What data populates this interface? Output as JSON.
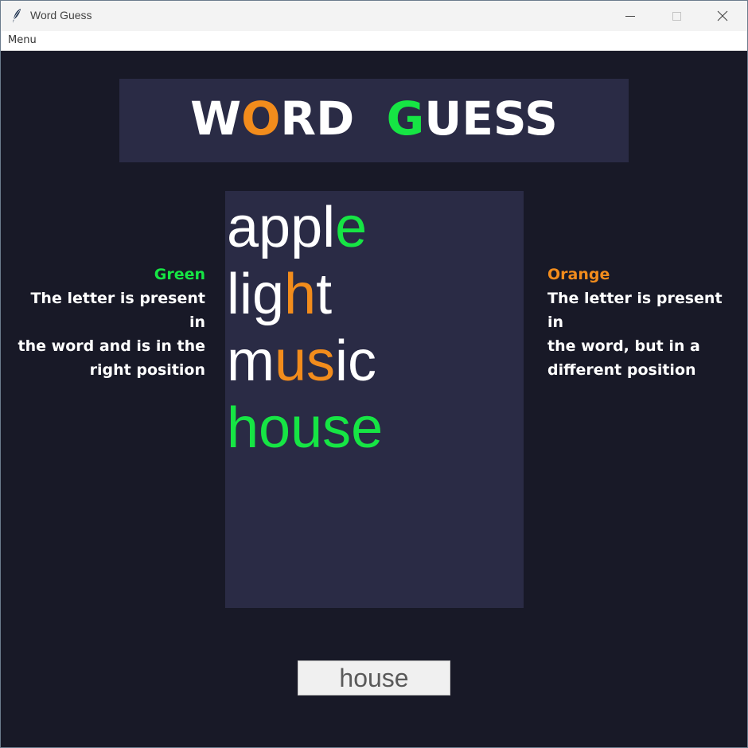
{
  "window": {
    "title": "Word Guess",
    "app_icon": "feather-icon",
    "controls": {
      "minimize": "minimize-icon",
      "maximize": "maximize-icon",
      "close": "close-icon"
    }
  },
  "menubar": {
    "items": [
      "Menu"
    ]
  },
  "header": {
    "segments": [
      {
        "text": "W",
        "color": "#ffffff"
      },
      {
        "text": "O",
        "color": "#f28c1c"
      },
      {
        "text": "RD  ",
        "color": "#ffffff"
      },
      {
        "text": "G",
        "color": "#16e544"
      },
      {
        "text": "UESS",
        "color": "#ffffff"
      }
    ]
  },
  "colors": {
    "green": "#16e544",
    "orange": "#f28c1c",
    "white": "#ffffff",
    "panel": "#2a2b45",
    "background": "#181927"
  },
  "guesses": [
    {
      "word": "apple",
      "letters": [
        {
          "ch": "a",
          "color": "#ffffff"
        },
        {
          "ch": "p",
          "color": "#ffffff"
        },
        {
          "ch": "p",
          "color": "#ffffff"
        },
        {
          "ch": "l",
          "color": "#ffffff"
        },
        {
          "ch": "e",
          "color": "#16e544"
        }
      ]
    },
    {
      "word": "light",
      "letters": [
        {
          "ch": "l",
          "color": "#ffffff"
        },
        {
          "ch": "i",
          "color": "#ffffff"
        },
        {
          "ch": "g",
          "color": "#ffffff"
        },
        {
          "ch": "h",
          "color": "#f28c1c"
        },
        {
          "ch": "t",
          "color": "#ffffff"
        }
      ]
    },
    {
      "word": "music",
      "letters": [
        {
          "ch": "m",
          "color": "#ffffff"
        },
        {
          "ch": "u",
          "color": "#f28c1c"
        },
        {
          "ch": "s",
          "color": "#f28c1c"
        },
        {
          "ch": "i",
          "color": "#ffffff"
        },
        {
          "ch": "c",
          "color": "#ffffff"
        }
      ]
    },
    {
      "word": "house",
      "letters": [
        {
          "ch": "h",
          "color": "#16e544"
        },
        {
          "ch": "o",
          "color": "#16e544"
        },
        {
          "ch": "u",
          "color": "#16e544"
        },
        {
          "ch": "s",
          "color": "#16e544"
        },
        {
          "ch": "e",
          "color": "#16e544"
        }
      ]
    }
  ],
  "legend": {
    "green": {
      "title": "Green",
      "description": "The letter is present in\nthe word and is in the\nright position"
    },
    "orange": {
      "title": "Orange",
      "description": "The letter is present in\nthe word, but in a\ndifferent position"
    }
  },
  "input": {
    "value": "house"
  }
}
